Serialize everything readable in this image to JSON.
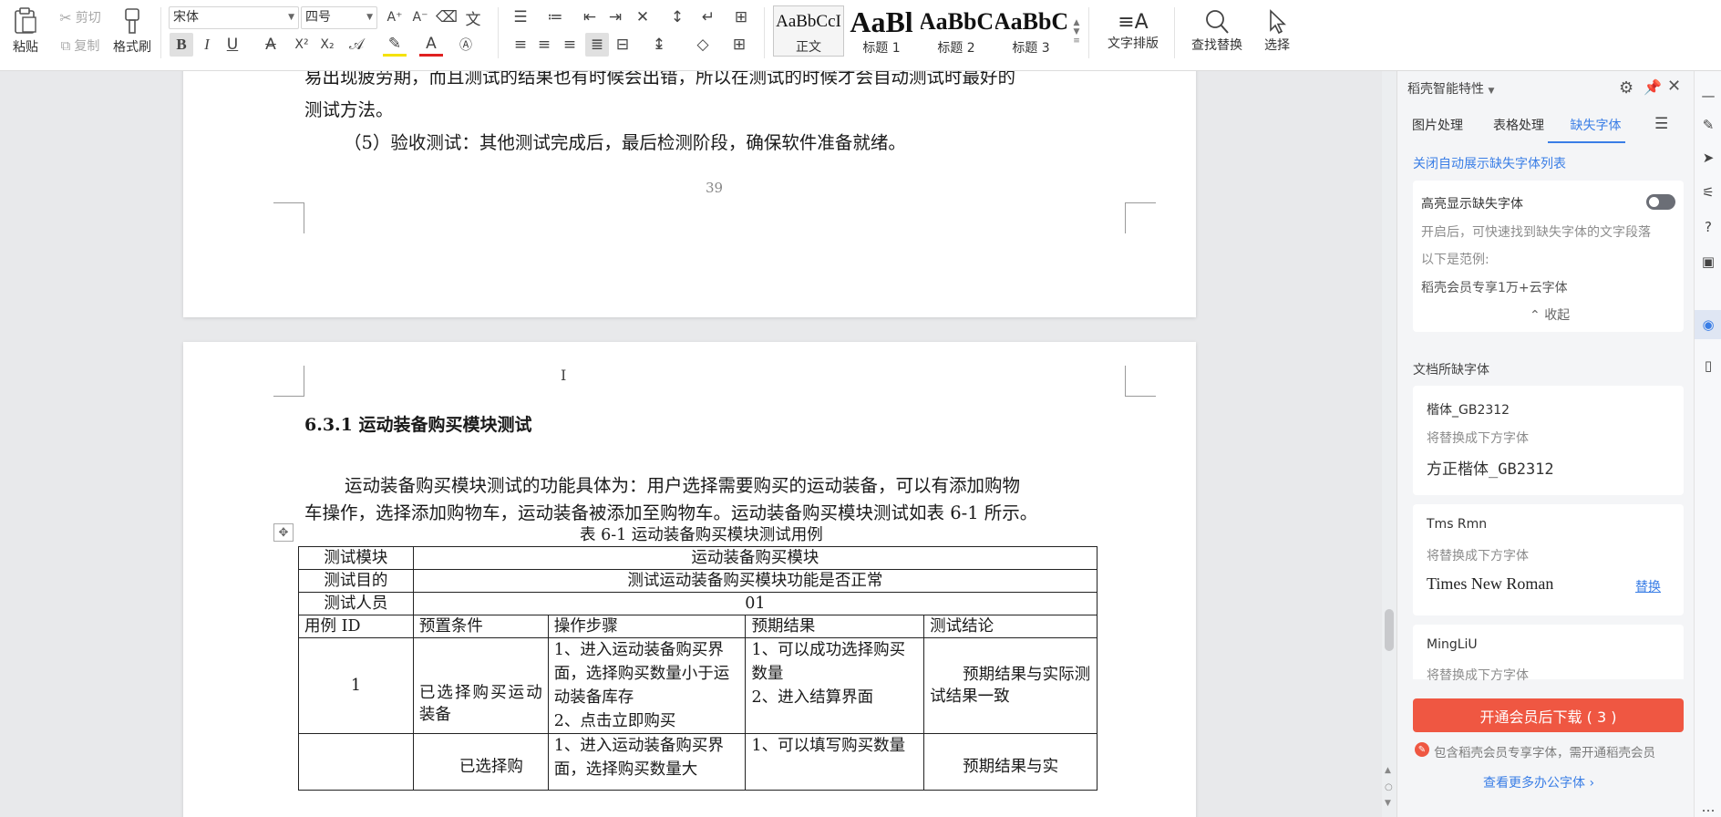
{
  "ribbon": {
    "paste_label": "粘贴",
    "cut_label": "剪切",
    "copy_label": "复制",
    "format_painter_label": "格式刷",
    "font_name": "宋体",
    "font_size": "四号",
    "styles": [
      {
        "sample": "AaBbCcI",
        "name": "正文"
      },
      {
        "sample": "AaBl",
        "name": "标题 1"
      },
      {
        "sample": "AaBbC",
        "name": "标题 2"
      },
      {
        "sample": "AaBbC",
        "name": "标题 3"
      }
    ],
    "text_layout_label": "文字排版",
    "find_replace_label": "查找替换",
    "select_label": "选择"
  },
  "document": {
    "page1": {
      "line1": "易出现疲劳期，而且测试的结果也有时候会出错，所以在测试的时候才会自动测试时最好的",
      "line2": "测试方法。",
      "line3": "（5）验收测试：其他测试完成后，最后检测阶段，确保软件准备就绪。",
      "page_number": "39"
    },
    "page2": {
      "heading": "6.3.1  运动装备购买模块测试",
      "para_line1": "运动装备购买模块测试的功能具体为：用户选择需要购买的运动装备，可以有添加购物",
      "para_line2": "车操作，选择添加购物车，运动装备被添加至购物车。运动装备购买模块测试如表 6-1 所示。",
      "table_caption": "表 6-1  运动装备购买模块测试用例",
      "table": {
        "module_label": "测试模块",
        "module_value": "运动装备购买模块",
        "purpose_label": "测试目的",
        "purpose_value": "测试运动装备购买模块功能是否正常",
        "tester_label": "测试人员",
        "tester_value": "01",
        "headers": [
          "用例 ID",
          "预置条件",
          "操作步骤",
          "预期结果",
          "测试结论"
        ],
        "row1": {
          "id": "1",
          "precondition": "已选择购买运动装备",
          "steps": "1、进入运动装备购买界面，选择购买数量小于运动装备库存\n2、点击立即购买",
          "expected": "1、可以成功选择购买数量\n2、进入结算界面",
          "conclusion": "预期结果与实际测试结果一致"
        },
        "row2": {
          "precondition": "已选择购",
          "steps": "1、进入运动装备购买界面，选择购买数量大",
          "expected": "1、可以填写购买数量",
          "conclusion": "预期结果与实"
        }
      }
    }
  },
  "panel": {
    "title": "稻壳智能特性",
    "tabs": [
      "图片处理",
      "表格处理",
      "缺失字体"
    ],
    "active_tab": "缺失字体",
    "close_auto_link": "关闭自动展示缺失字体列表",
    "highlight": {
      "title": "高亮显示缺失字体",
      "enabled": false,
      "desc_line1": "开启后，可快速找到缺失字体的文字段落",
      "desc_line2": "以下是范例:",
      "example": "稻壳会员专享1万+云字体",
      "collapse_label": "收起"
    },
    "missing_section_title": "文档所缺字体",
    "missing_fonts": [
      {
        "name": "楷体_GB2312",
        "hint": "将替换成下方字体",
        "replacement": "方正楷体_GB2312",
        "action": ""
      },
      {
        "name": "Tms Rmn",
        "hint": "将替换成下方字体",
        "replacement": "Times New Roman",
        "action": "替换"
      },
      {
        "name": "MingLiU",
        "hint": "将替换成下方字体",
        "replacement": "",
        "action": ""
      }
    ],
    "download_button": "开通会员后下载 ( 3 )",
    "member_note": "包含稻壳会员专享字体，需开通稻壳会员",
    "more_fonts_link": "查看更多办公字体",
    "accent_color": "#ef5742",
    "link_color": "#3a7ee6"
  }
}
